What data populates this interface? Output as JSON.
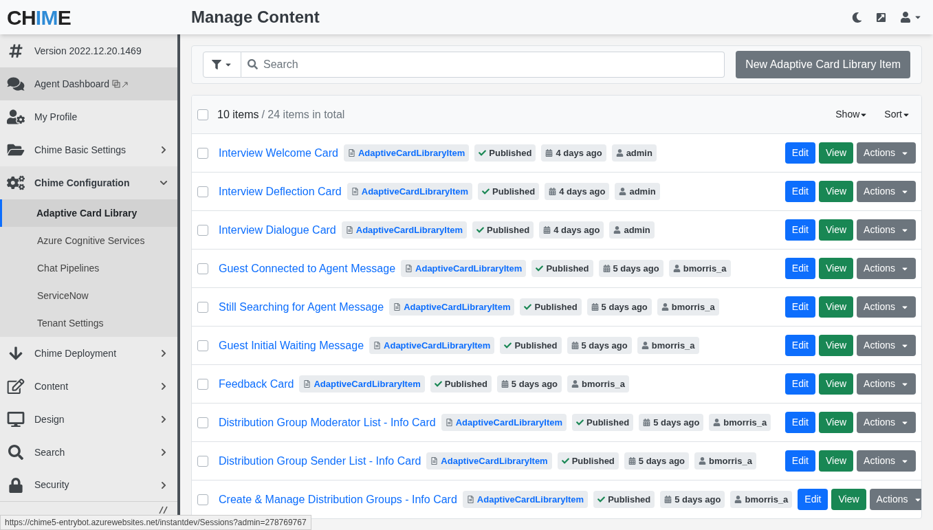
{
  "header": {
    "logo": {
      "left": "CH",
      "accent": "IM",
      "right": "E"
    },
    "title": "Manage Content"
  },
  "sidebar": {
    "items": [
      {
        "label": "Version 2022.12.20.1469",
        "hovered": false
      },
      {
        "label": "Agent Dashboard",
        "hovered": true,
        "external": true
      },
      {
        "label": "My Profile",
        "hovered": false
      },
      {
        "label": "Chime Basic Settings",
        "hovered": false,
        "expanded": false
      },
      {
        "label": "Chime Configuration",
        "hovered": false,
        "expanded": true,
        "children": [
          {
            "label": "Adaptive Card Library",
            "selected": true
          },
          {
            "label": "Azure Cognitive Services",
            "selected": false
          },
          {
            "label": "Chat Pipelines",
            "selected": false
          },
          {
            "label": "ServiceNow",
            "selected": false
          },
          {
            "label": "Tenant Settings",
            "selected": false
          }
        ]
      },
      {
        "label": "Chime Deployment",
        "hovered": false,
        "expanded": false
      },
      {
        "label": "Content",
        "hovered": false,
        "expanded": false
      },
      {
        "label": "Design",
        "hovered": false,
        "expanded": false
      },
      {
        "label": "Search",
        "hovered": false,
        "expanded": false
      },
      {
        "label": "Security",
        "hovered": false,
        "expanded": false
      }
    ]
  },
  "toolbar": {
    "search": {
      "placeholder": "Search"
    },
    "new_button": "New Adaptive Card Library Item"
  },
  "list": {
    "select_all": {
      "checked": false
    },
    "count": "10 items",
    "total": "/ 24 items in total",
    "show": "Show",
    "sort": "Sort",
    "rows": [
      {
        "title": "Interview Welcome Card",
        "type": "AdaptiveCardLibraryItem",
        "status": "Published",
        "age": "4 days ago",
        "owner": "admin",
        "checked": false
      },
      {
        "title": "Interview Deflection Card",
        "type": "AdaptiveCardLibraryItem",
        "status": "Published",
        "age": "4 days ago",
        "owner": "admin",
        "checked": false
      },
      {
        "title": "Interview Dialogue Card",
        "type": "AdaptiveCardLibraryItem",
        "status": "Published",
        "age": "4 days ago",
        "owner": "admin",
        "checked": false
      },
      {
        "title": "Guest Connected to Agent Message",
        "type": "AdaptiveCardLibraryItem",
        "status": "Published",
        "age": "5 days ago",
        "owner": "bmorris_a",
        "checked": false
      },
      {
        "title": "Still Searching for Agent Message",
        "type": "AdaptiveCardLibraryItem",
        "status": "Published",
        "age": "5 days ago",
        "owner": "bmorris_a",
        "checked": false
      },
      {
        "title": "Guest Initial Waiting Message",
        "type": "AdaptiveCardLibraryItem",
        "status": "Published",
        "age": "5 days ago",
        "owner": "bmorris_a",
        "checked": false
      },
      {
        "title": "Feedback Card",
        "type": "AdaptiveCardLibraryItem",
        "status": "Published",
        "age": "5 days ago",
        "owner": "bmorris_a",
        "checked": false
      },
      {
        "title": "Distribution Group Moderator List - Info Card",
        "type": "AdaptiveCardLibraryItem",
        "status": "Published",
        "age": "5 days ago",
        "owner": "bmorris_a",
        "checked": false
      },
      {
        "title": "Distribution Group Sender List - Info Card",
        "type": "AdaptiveCardLibraryItem",
        "status": "Published",
        "age": "5 days ago",
        "owner": "bmorris_a",
        "checked": false
      },
      {
        "title": "Create & Manage Distribution Groups - Info Card",
        "type": "AdaptiveCardLibraryItem",
        "status": "Published",
        "age": "5 days ago",
        "owner": "bmorris_a",
        "checked": false
      }
    ],
    "row_buttons": [
      {
        "edit": "Edit",
        "view": "View",
        "actions": "Actions"
      },
      {
        "edit": "Edit",
        "view": "View",
        "actions": "Actions"
      },
      {
        "edit": "Edit",
        "view": "View",
        "actions": "Actions"
      },
      {
        "edit": "Edit",
        "view": "View",
        "actions": "Actions"
      },
      {
        "edit": "Edit",
        "view": "View",
        "actions": "Actions"
      },
      {
        "edit": "Edit",
        "view": "View",
        "actions": "Actions"
      },
      {
        "edit": "Edit",
        "view": "View",
        "actions": "Actions"
      },
      {
        "edit": "Edit",
        "view": "View",
        "actions": "Actions"
      },
      {
        "edit": "Edit",
        "view": "View",
        "actions": "Actions"
      },
      {
        "edit": "Edit",
        "view": "View",
        "actions": "Actions"
      }
    ]
  },
  "status_bar": {
    "url": "https://chime5-entrybot.azurewebsites.net/instantdev/Sessions?admin=278769767"
  }
}
